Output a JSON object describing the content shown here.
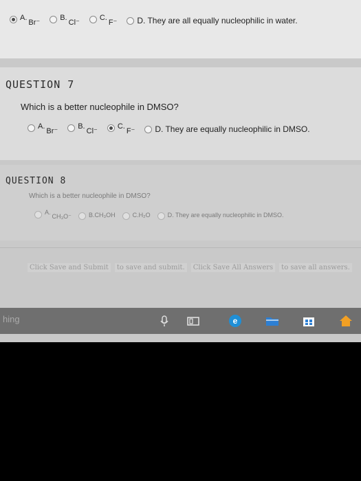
{
  "question6": {
    "options": [
      {
        "letter": "A.",
        "text": "Br⁻",
        "checked": true
      },
      {
        "letter": "B.",
        "text": "Cl⁻",
        "checked": false
      },
      {
        "letter": "C.",
        "text": "F⁻",
        "checked": false
      },
      {
        "letter": "",
        "text": "D. They are all equally nucleophilic in water.",
        "checked": false
      }
    ]
  },
  "question7": {
    "title": "QUESTION 7",
    "text": "Which is a better nucleophile in DMSO?",
    "options": [
      {
        "letter": "A.",
        "text": "Br⁻",
        "checked": false
      },
      {
        "letter": "B.",
        "text": "Cl⁻",
        "checked": false
      },
      {
        "letter": "C.",
        "text": "F⁻",
        "checked": true
      },
      {
        "letter": "",
        "text": "D. They are equally nucleophilic in DMSO.",
        "checked": false
      }
    ]
  },
  "question8": {
    "title": "QUESTION 8",
    "text": "Which is a better nucleophile in DMSO?",
    "options": [
      {
        "letter": "A.",
        "text": "CH₃O⁻",
        "checked": false
      },
      {
        "letter": "B.",
        "text": "CH₃OH",
        "checked": false
      },
      {
        "letter": "C.",
        "text": "H₂O",
        "checked": false
      },
      {
        "letter": "",
        "text": "D. They are equally nucleophilic in DMSO.",
        "checked": false
      }
    ]
  },
  "buttons": {
    "save_submit": "Click Save and Submit",
    "save_submit_hint": "to save and submit.",
    "save_all": "Click Save All Answers",
    "save_all_hint": "to save all answers."
  },
  "taskbar": {
    "search_text": "hing",
    "icons": [
      "microphone-icon",
      "task-view-icon",
      "edge-icon",
      "folder-icon",
      "store-icon",
      "home-icon"
    ]
  },
  "colors": {
    "taskbar": "#6f6f6f",
    "edge": "#1f8fd6",
    "store": "#2d7fd3",
    "home": "#f2a024"
  }
}
